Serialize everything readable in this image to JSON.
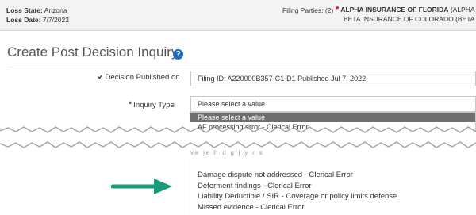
{
  "header": {
    "loss_state_label": "Loss State:",
    "loss_state_value": "Arizona",
    "loss_date_label": "Loss Date:",
    "loss_date_value": "7/7/2022",
    "filing_parties_label": "Filing Parties: (2)",
    "party1": "ALPHA INSURANCE OF FLORIDA",
    "party1_suffix": "(ALPHA REG",
    "party2": "BETA INSURANCE OF COLORADO",
    "party2_suffix": "(BETA RESP"
  },
  "page": {
    "title": "Create Post Decision Inquiry",
    "help_icon": "?"
  },
  "form": {
    "decision_label": "Decision Published on",
    "decision_value": "Filing ID: A220000B357-C1-D1 Published Jul 7, 2022",
    "inquiry_label": "Inquiry Type",
    "inquiry_placeholder": "Please select a value"
  },
  "dropdown": {
    "options_top": [
      "Please select a value",
      "AF processing error - Clerical Error"
    ],
    "ghost_text": "ve  je  h  d     g     j  y     r  s",
    "options_bottom": [
      "Damage dispute not addressed - Clerical Error",
      "Deferment findings - Clerical Error",
      "Liability Deductible / SIR - Coverage or policy limits defense",
      "Missed evidence - Clerical Error"
    ]
  },
  "colors": {
    "accent": "#1f6fc2",
    "required": "#d0021b",
    "arrow": "#1a9a78",
    "selected": "#6f6f6f"
  }
}
